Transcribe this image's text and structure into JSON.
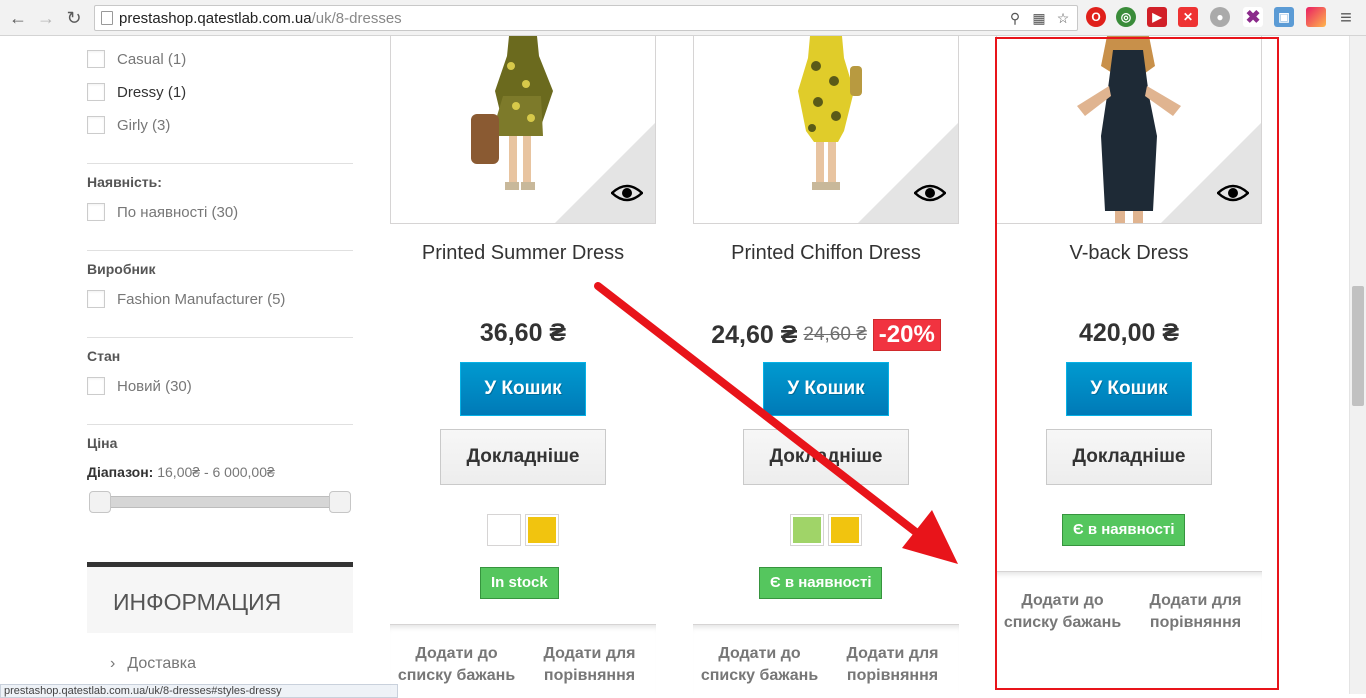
{
  "browser": {
    "url_host": "prestashop.qatestlab.com.ua",
    "url_path": "/uk/8-dresses"
  },
  "sidebar": {
    "styles": [
      {
        "label": "Casual (1)"
      },
      {
        "label": "Dressy (1)"
      },
      {
        "label": "Girly (3)"
      }
    ],
    "availability_title": "Наявність:",
    "availability_option": "По наявності (30)",
    "manufacturer_title": "Виробник",
    "manufacturer_option": "Fashion Manufacturer (5)",
    "condition_title": "Стан",
    "condition_option": "Новий (30)",
    "price_title": "Ціна",
    "range_label": "Діапазон:",
    "range_value": " 16,00₴ - 6 000,00₴",
    "info_title": "ИНФОРМАЦИЯ",
    "info_link": "Доставка"
  },
  "status_url": "prestashop.qatestlab.com.ua/uk/8-dresses#styles-dressy",
  "products": [
    {
      "name": "Printed Summer Dress",
      "price": "36,60 ₴",
      "cart": "У Кошик",
      "more": "Докладніше",
      "swatches": [
        "#ffffff",
        "#f1c40f"
      ],
      "stock": "In stock",
      "wishlist": "Додати до списку бажань",
      "compare": "Додати для порівняння"
    },
    {
      "name": "Printed Chiffon Dress",
      "price": "24,60 ₴",
      "old_price": "24,60 ₴",
      "discount": "-20%",
      "cart": "У Кошик",
      "more": "Докладніше",
      "swatches": [
        "#a0d468",
        "#f1c40f"
      ],
      "stock": "Є в наявності",
      "wishlist": "Додати до списку бажань",
      "compare": "Додати для порівняння"
    },
    {
      "name": "V-back Dress",
      "price": "420,00 ₴",
      "cart": "У Кошик",
      "more": "Докладніше",
      "stock": "Є в наявності",
      "wishlist": "Додати до списку бажань",
      "compare": "Додати для порівняння"
    }
  ],
  "colors": {
    "cart_button": "#0089c7",
    "stock_badge": "#55c65e",
    "discount_badge": "#f13340",
    "annotation": "#e8141a"
  }
}
